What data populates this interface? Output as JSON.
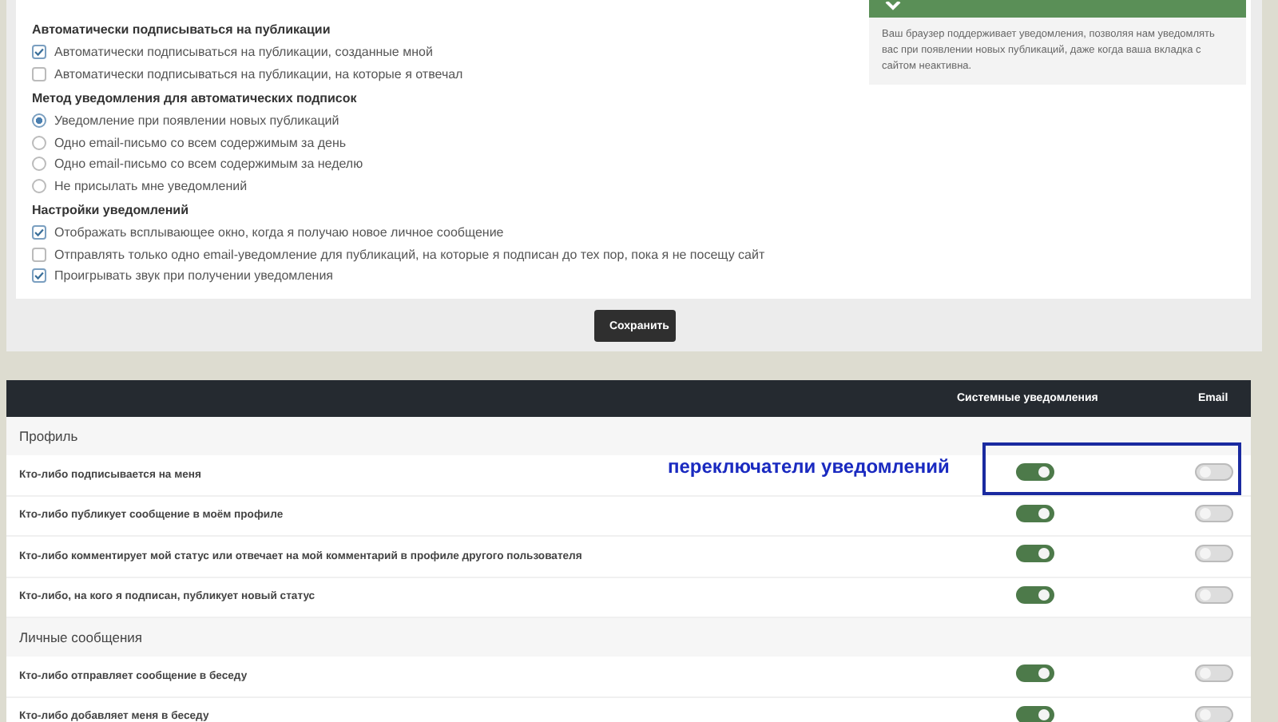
{
  "subscriptions": {
    "heading": "Автоматически подписываться на публикации",
    "options": [
      {
        "label": "Автоматически подписываться на публикации, созданные мной",
        "checked": true
      },
      {
        "label": "Автоматически подписываться на публикации, на которые я отвечал",
        "checked": false
      }
    ]
  },
  "method": {
    "heading": "Метод уведомления для автоматических подписок",
    "options": [
      {
        "label": "Уведомление при появлении новых публикаций",
        "selected": true
      },
      {
        "label": "Одно email-письмо со всем содержимым за день",
        "selected": false
      },
      {
        "label": "Одно email-письмо со всем содержимым за неделю",
        "selected": false
      },
      {
        "label": "Не присылать мне уведомлений",
        "selected": false
      }
    ]
  },
  "settings": {
    "heading": "Настройки уведомлений",
    "options": [
      {
        "label": "Отображать всплывающее окно, когда я получаю новое личное сообщение",
        "checked": true
      },
      {
        "label": "Отправлять только одно email-уведомление для публикаций, на которые я подписан до тех пор, пока я не посещу сайт",
        "checked": false
      },
      {
        "label": "Проигрывать звук при получении уведомления",
        "checked": true
      }
    ]
  },
  "browser_notice": {
    "text": "Ваш браузер поддерживает уведомления, позволяя нам уведомлять вас при появлении новых публикаций, даже когда ваша вкладка с сайтом неактивна."
  },
  "save_button": "Сохранить",
  "table": {
    "columns": [
      "Системные уведомления",
      "Email"
    ],
    "sections": [
      {
        "title": "Профиль",
        "rows": [
          {
            "label": "Кто-либо подписывается на меня",
            "system_on": true,
            "email_on": false
          },
          {
            "label": "Кто-либо публикует сообщение в моём профиле",
            "system_on": true,
            "email_on": false
          },
          {
            "label": "Кто-либо комментирует мой статус или отвечает на мой комментарий в профиле другого пользователя",
            "system_on": true,
            "email_on": false
          },
          {
            "label": "Кто-либо, на кого я подписан, публикует новый статус",
            "system_on": true,
            "email_on": false
          }
        ]
      },
      {
        "title": "Личные сообщения",
        "rows": [
          {
            "label": "Кто-либо отправляет сообщение в беседу",
            "system_on": true,
            "email_on": false
          },
          {
            "label": "Кто-либо добавляет меня в беседу",
            "system_on": true,
            "email_on": false
          }
        ]
      }
    ]
  },
  "annotation": "переключатели уведомлений"
}
